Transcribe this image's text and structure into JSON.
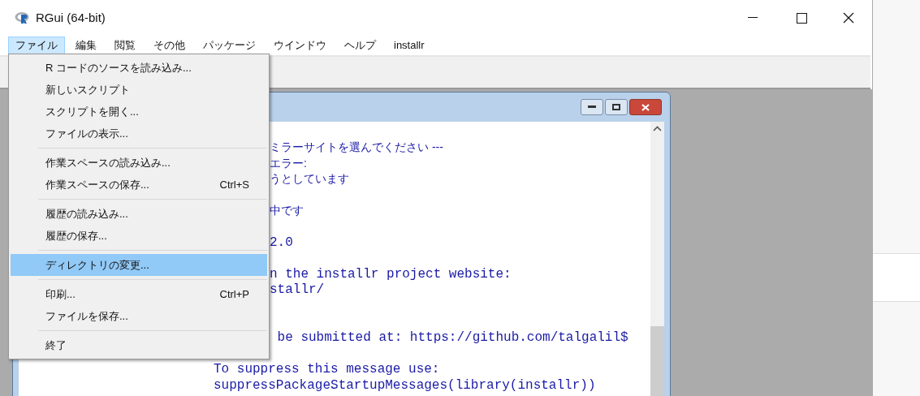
{
  "window": {
    "title": "RGui (64-bit)"
  },
  "menubar": [
    {
      "label": "ファイル",
      "selected": true
    },
    {
      "label": "編集",
      "selected": false
    },
    {
      "label": "閲覧",
      "selected": false
    },
    {
      "label": "その他",
      "selected": false
    },
    {
      "label": "パッケージ",
      "selected": false
    },
    {
      "label": "ウインドウ",
      "selected": false
    },
    {
      "label": "ヘルプ",
      "selected": false
    },
    {
      "label": "installr",
      "selected": false
    }
  ],
  "file_menu": [
    {
      "kind": "item",
      "label": "R コードのソースを読み込み...",
      "selected": false
    },
    {
      "kind": "item",
      "label": "新しいスクリプト",
      "selected": false
    },
    {
      "kind": "item",
      "label": "スクリプトを開く...",
      "selected": false
    },
    {
      "kind": "item",
      "label": "ファイルの表示...",
      "selected": false
    },
    {
      "kind": "separator"
    },
    {
      "kind": "item",
      "label": "作業スペースの読み込み...",
      "selected": false
    },
    {
      "kind": "item",
      "label": "作業スペースの保存...",
      "shortcut": "Ctrl+S",
      "selected": false
    },
    {
      "kind": "separator"
    },
    {
      "kind": "item",
      "label": "履歴の読み込み...",
      "selected": false
    },
    {
      "kind": "item",
      "label": "履歴の保存...",
      "selected": false
    },
    {
      "kind": "separator"
    },
    {
      "kind": "item",
      "label": "ディレクトリの変更...",
      "selected": true
    },
    {
      "kind": "separator"
    },
    {
      "kind": "item",
      "label": "印刷...",
      "shortcut": "Ctrl+P",
      "selected": false
    },
    {
      "kind": "item",
      "label": "ファイルを保存...",
      "selected": false
    },
    {
      "kind": "separator"
    },
    {
      "kind": "item",
      "label": "終了",
      "selected": false
    }
  ],
  "console": {
    "blocks": [
      [
        {
          "kind": "jp",
          "text": "ミラーサイトを選んでください ---"
        },
        {
          "kind": "jp",
          "text": "エラー:"
        },
        {
          "kind": "jp",
          "text": "うとしています"
        }
      ],
      [
        {
          "kind": "jp",
          "text": "中です"
        }
      ],
      [
        {
          "kind": "code",
          "text": "2.0"
        }
      ],
      [
        {
          "kind": "code",
          "text": "n the installr project website:"
        },
        {
          "kind": "code",
          "text": "stallr/"
        }
      ],
      [
        {
          "kind": "code",
          "text": " be submitted at: https://github.com/talgalil$"
        }
      ],
      [
        {
          "kind": "code",
          "text": "To suppress this message use:"
        },
        {
          "kind": "code",
          "text": "suppressPackageStartupMessages(library(installr))"
        }
      ]
    ]
  }
}
